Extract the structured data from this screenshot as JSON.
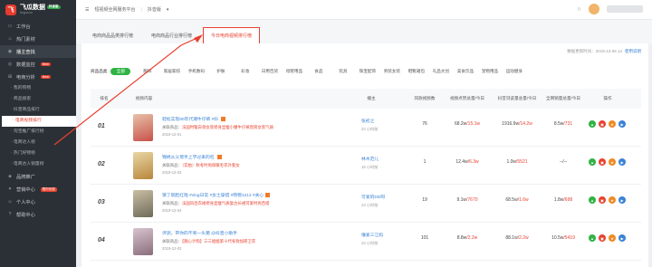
{
  "brand": {
    "name": "飞瓜数据",
    "badge": "抖音版",
    "sub": "feigua.cn"
  },
  "sidebar": {
    "items": [
      {
        "label": "工作台",
        "icon": "desktop-icon"
      },
      {
        "label": "热门素材",
        "icon": "fire-icon"
      },
      {
        "label": "播主查找",
        "icon": "user-search-icon",
        "active": true
      },
      {
        "label": "数据监控",
        "icon": "monitor-icon",
        "badge": "New"
      },
      {
        "label": "电商分析",
        "icon": "cart-icon",
        "badge": "New"
      }
    ],
    "subitems": [
      "· 我的购物",
      "· 商品搜索",
      "· 抖音商品排行",
      "· 电商视频排行",
      "· 淘宝推广排行榜",
      "· 电商达人榜",
      "· 热门好物榜",
      "· 电商达人销量榜"
    ],
    "bottom": [
      {
        "label": "品牌推广",
        "icon": "brand-icon"
      },
      {
        "label": "营销中心",
        "icon": "marketing-icon",
        "badge": "限时优惠"
      },
      {
        "label": "个人中心",
        "icon": "person-icon"
      },
      {
        "label": "帮助中心",
        "icon": "help-icon"
      }
    ]
  },
  "topbar": {
    "title": "短视频全网服务平台",
    "platform": "抖音版"
  },
  "tabs": [
    "电商商品品类排行榜",
    "电商商品行业排行榜",
    "今日电商视频排行榜"
  ],
  "updated": {
    "label": "数据更新时间：2019-12-06 14",
    "link": "使用说明"
  },
  "categories": {
    "label": "商品品类",
    "items": [
      "全部",
      "服饰",
      "家居家纺",
      "手机数码",
      "护肤",
      "彩妆",
      "日用百货",
      "母婴用品",
      "食品",
      "玩具",
      "珠宝配饰",
      "男装女装",
      "鞋靴箱包",
      "礼品文创",
      "美食饮品",
      "宠物用品",
      "运动健身"
    ]
  },
  "columns": [
    "排名",
    "视频内容",
    "播主",
    "同款视频数",
    "视频点赞总量/今日",
    "抖音浏览量总量/今日",
    "全网销量总量/今日",
    "操作"
  ],
  "rows": [
    {
      "rank": "01",
      "title": "轻松实现80年代潮牛仔裤 #抖 ",
      "product": "关联商品：",
      "product_name": "法国时髦白领女装修身显瘦小腰牛仔裤直筒女装气质",
      "date": "2019-12-01",
      "host": "张初之",
      "host_time": "23 小时前",
      "same": "76",
      "likes_total": "68.2w",
      "likes_today": "/15.1w",
      "views_total": "1916.9w",
      "views_today": "/14.2w",
      "sales_total": "8.5w",
      "sales_today": "/731",
      "thumb": "#c9504a"
    },
    {
      "rank": "02",
      "title": "锦绣从父母手上学过来的包 ",
      "product": "关联商品：",
      "product_name": "（实拍）秋冬时尚保暖毛衣外套女",
      "date": "2019-12-02",
      "host": "林木范儿",
      "host_time": "15 小时前",
      "same": "1",
      "likes_total": "12.4w",
      "likes_today": "/6.3w",
      "views_total": "1.0w",
      "views_today": "/5521",
      "sales_total": "",
      "sales_today": "--/--",
      "thumb": "#b8873c"
    },
    {
      "rank": "03",
      "title": "猜了就脸红啦 #vlog日常 #女士穿搭 #购物1212 #关心",
      "product": "关联商品：",
      "product_name": "法国风连衣裙修身显瘦气质复古长裙可爱时尚百搭",
      "date": "2019-12-04",
      "host": "可爱的DD呀",
      "host_time": "23 小时前",
      "same": "19",
      "likes_total": "9.1w",
      "likes_today": "/7670",
      "views_total": "68.5w",
      "views_today": "/1.6w",
      "sales_total": "1.8w",
      "sales_today": "/698",
      "thumb": "#6f6a5a"
    },
    {
      "rank": "04",
      "title": "评测，带你的不到一头猪 @抖音小助手",
      "product": "关联商品：",
      "product_name": "【随心计购】三三姐姐第十代冬款加厚卫衣",
      "date": "2019-12-02",
      "host": "懂爱三江妈",
      "host_time": "23 小时前",
      "same": "101",
      "likes_total": "8.8w",
      "likes_today": "/2.2w",
      "views_total": "88.1w",
      "views_today": "/2.2w",
      "sales_total": "10.5w",
      "sales_today": "/5419",
      "thumb": "#8a6d7a"
    }
  ],
  "colors": {
    "accent": "#e8412f",
    "brand": "#2fb344",
    "link": "#3b82d4"
  }
}
